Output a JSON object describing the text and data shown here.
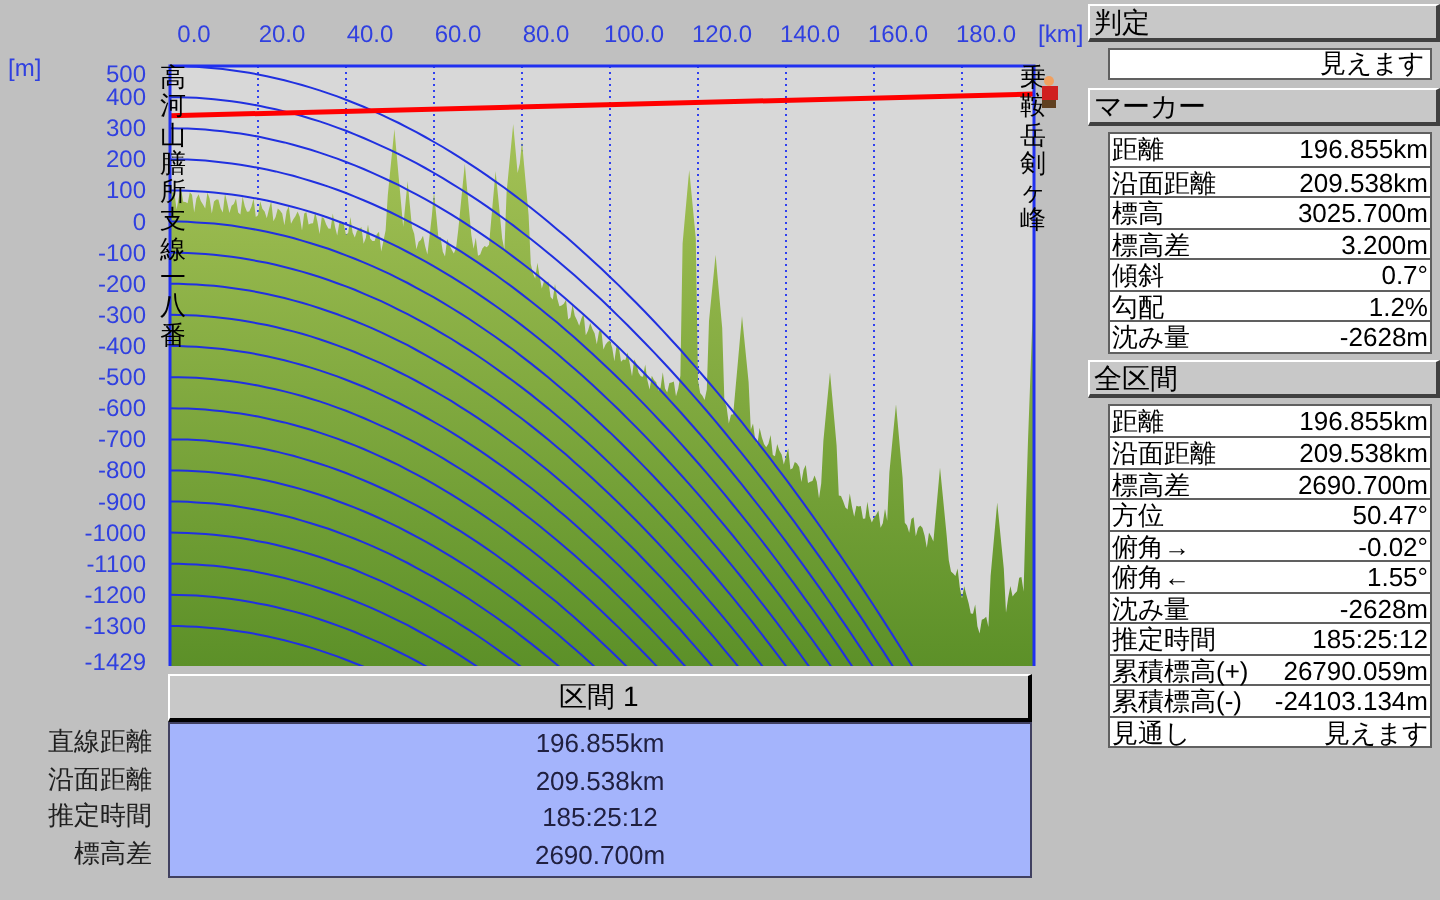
{
  "chart": {
    "start_label": "高河山膳所支線一八番",
    "end_label": "乗鞍岳剣ヶ峰",
    "x_unit": "[km]",
    "y_unit": "[m]",
    "x_ticks": [
      "0.0",
      "20.0",
      "40.0",
      "60.0",
      "80.0",
      "100.0",
      "120.0",
      "140.0",
      "160.0",
      "180.0"
    ],
    "y_ticks": [
      "500",
      "400",
      "300",
      "200",
      "100",
      "0",
      "-100",
      "-200",
      "-300",
      "-400",
      "-500",
      "-600",
      "-700",
      "-800",
      "-900",
      "-1000",
      "-1100",
      "-1200",
      "-1300"
    ],
    "y_min_label": "-1429"
  },
  "section": {
    "title": "区間 1",
    "rows": [
      {
        "label": "直線距離",
        "value": "196.855km"
      },
      {
        "label": "沿面距離",
        "value": "209.538km"
      },
      {
        "label": "推定時間",
        "value": "185:25:12"
      },
      {
        "label": "標高差",
        "value": "2690.700m"
      }
    ]
  },
  "judgement": {
    "title": "判定",
    "value": "見えます"
  },
  "marker": {
    "title": "マーカー",
    "rows": [
      {
        "label": "距離",
        "value": "196.855km"
      },
      {
        "label": "沿面距離",
        "value": "209.538km"
      },
      {
        "label": "標高",
        "value": "3025.700m"
      },
      {
        "label": "標高差",
        "value": "3.200m"
      },
      {
        "label": "傾斜",
        "value": "0.7°"
      },
      {
        "label": "勾配",
        "value": "1.2%"
      },
      {
        "label": "沈み量",
        "value": "-2628m"
      }
    ]
  },
  "whole": {
    "title": "全区間",
    "rows": [
      {
        "label": "距離",
        "value": "196.855km"
      },
      {
        "label": "沿面距離",
        "value": "209.538km"
      },
      {
        "label": "標高差",
        "value": "2690.700m"
      },
      {
        "label": "方位",
        "value": "50.47°"
      },
      {
        "label": "俯角→",
        "value": "-0.02°"
      },
      {
        "label": "俯角←",
        "value": "1.55°"
      },
      {
        "label": "沈み量",
        "value": "-2628m"
      },
      {
        "label": "推定時間",
        "value": "185:25:12"
      },
      {
        "label": "累積標高(+)",
        "value": "26790.059m"
      },
      {
        "label": "累積標高(-)",
        "value": "-24103.134m"
      },
      {
        "label": "見通し",
        "value": "見えます"
      }
    ]
  }
}
